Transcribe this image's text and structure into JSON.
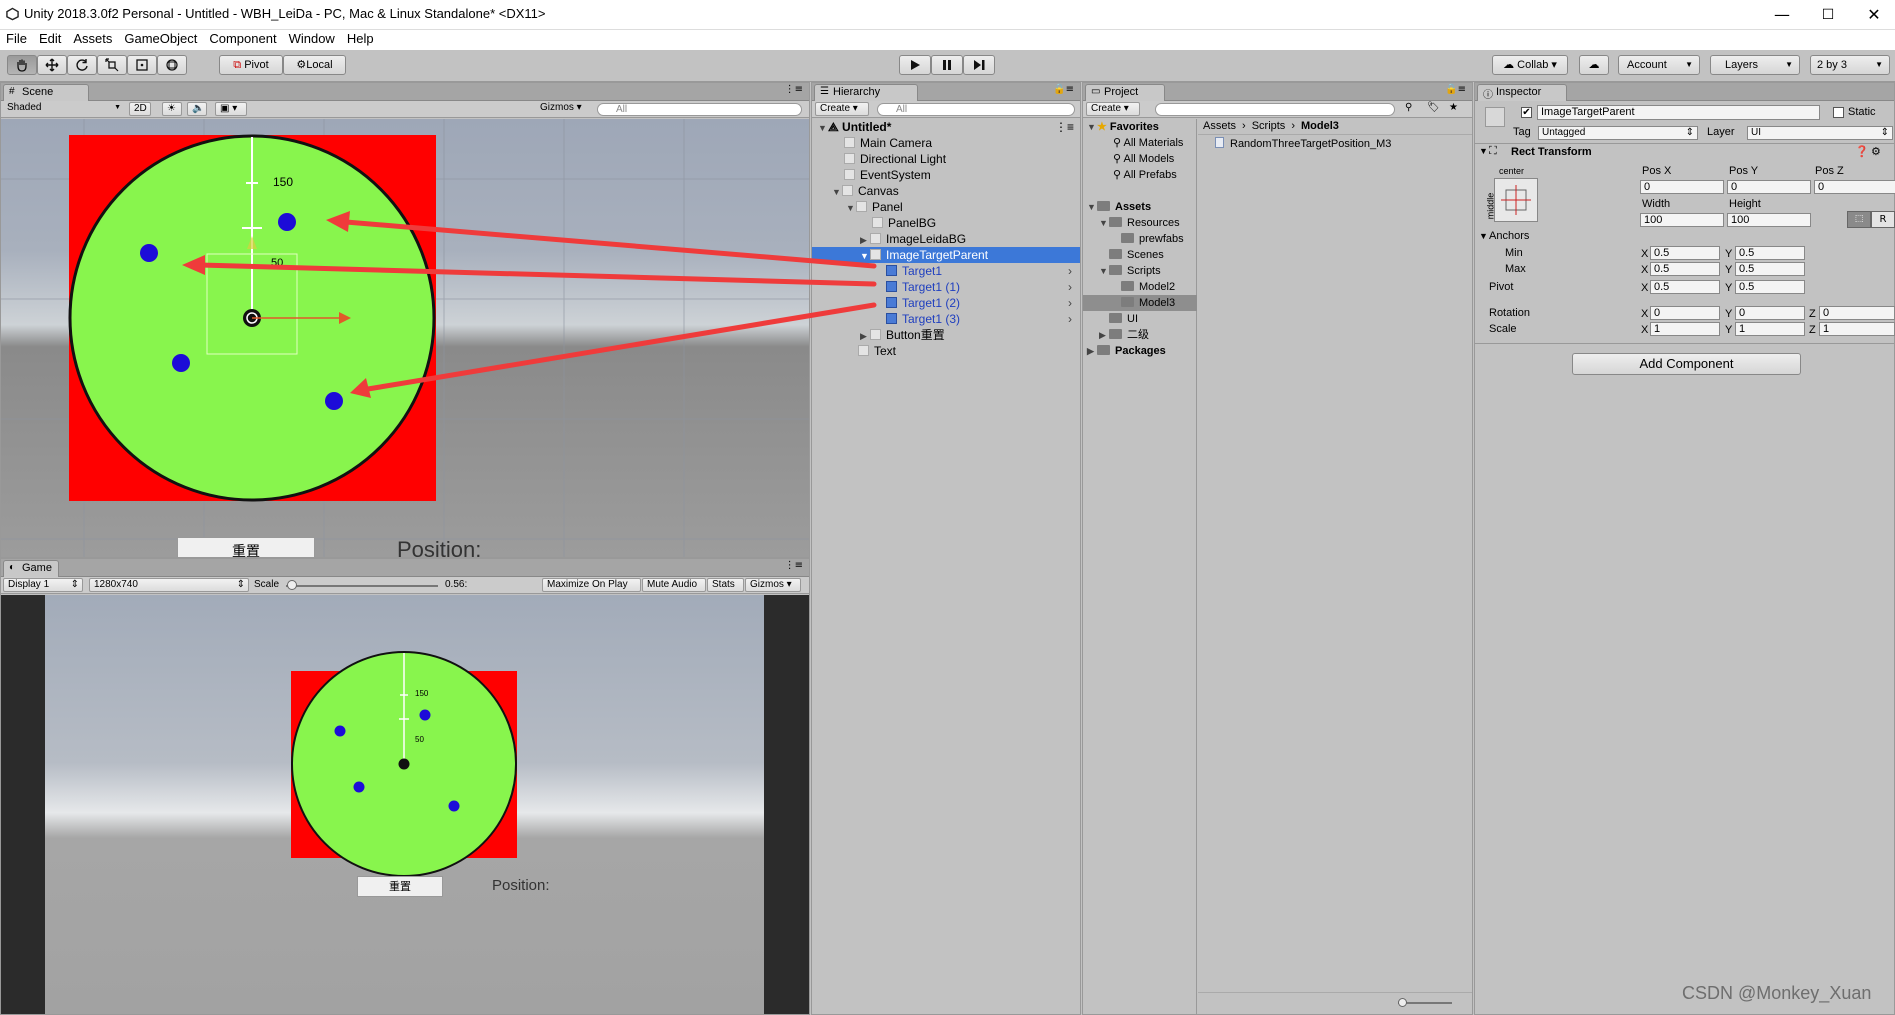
{
  "window": {
    "title": "Unity 2018.3.0f2 Personal - Untitled - WBH_LeiDa - PC, Mac & Linux Standalone* <DX11>",
    "minimize": "—",
    "maximize": "☐",
    "close": "✕"
  },
  "menu": [
    "File",
    "Edit",
    "Assets",
    "GameObject",
    "Component",
    "Window",
    "Help"
  ],
  "toolbar": {
    "pivot": "Pivot",
    "local": "Local",
    "collab": "Collab ▾",
    "account": "Account",
    "layers": "Layers",
    "layout": "2 by 3"
  },
  "scene": {
    "tab": "Scene",
    "shading": "Shaded",
    "mode2d": "2D",
    "gizmos": "Gizmos",
    "search": "All",
    "label_150": "150",
    "label_50": "50",
    "button_text": "重置",
    "position_text": "Position:"
  },
  "game": {
    "tab": "Game",
    "display": "Display 1",
    "resolution": "1280x740",
    "scale_label": "Scale",
    "scale_value": "0.56:",
    "maximize": "Maximize On Play",
    "mute": "Mute Audio",
    "stats": "Stats",
    "gizmos": "Gizmos",
    "label_150": "150",
    "label_50": "50",
    "button_text": "重置",
    "position_text": "Position:"
  },
  "hierarchy": {
    "tab": "Hierarchy",
    "create": "Create",
    "search": "All",
    "scene_root": "Untitled*",
    "items": [
      {
        "label": "Main Camera"
      },
      {
        "label": "Directional Light"
      },
      {
        "label": "EventSystem"
      },
      {
        "label": "Canvas"
      },
      {
        "label": "Panel"
      },
      {
        "label": "PanelBG"
      },
      {
        "label": "ImageLeidaBG"
      },
      {
        "label": "ImageTargetParent"
      },
      {
        "label": "Target1"
      },
      {
        "label": "Target1 (1)"
      },
      {
        "label": "Target1 (2)"
      },
      {
        "label": "Target1 (3)"
      },
      {
        "label": "Button重置"
      },
      {
        "label": "Text"
      }
    ]
  },
  "project": {
    "tab": "Project",
    "create": "Create",
    "favorites": "Favorites",
    "fav_items": [
      "All Materials",
      "All Models",
      "All Prefabs"
    ],
    "assets": "Assets",
    "asset_tree": [
      "Resources",
      "prewfabs",
      "Scenes",
      "Scripts",
      "Model2",
      "Model3",
      "UI",
      "二级"
    ],
    "packages": "Packages",
    "breadcrumb": [
      "Assets",
      "Scripts",
      "Model3"
    ],
    "file": "RandomThreeTargetPosition_M3"
  },
  "inspector": {
    "tab": "Inspector",
    "object_name": "ImageTargetParent",
    "static": "Static",
    "tag_label": "Tag",
    "tag_value": "Untagged",
    "layer_label": "Layer",
    "layer_value": "UI",
    "component": "Rect Transform",
    "anchor_h": "center",
    "anchor_v": "middle",
    "posx_label": "Pos X",
    "posy_label": "Pos Y",
    "posz_label": "Pos Z",
    "posx": "0",
    "posy": "0",
    "posz": "0",
    "width_label": "Width",
    "height_label": "Height",
    "width": "100",
    "height": "100",
    "r_button": "R",
    "anchors": "Anchors",
    "min": "Min",
    "max": "Max",
    "pivot": "Pivot",
    "rotation": "Rotation",
    "scale": "Scale",
    "min_x": "0.5",
    "min_y": "0.5",
    "max_x": "0.5",
    "max_y": "0.5",
    "pivot_x": "0.5",
    "pivot_y": "0.5",
    "rot_x": "0",
    "rot_y": "0",
    "rot_z": "0",
    "scale_x": "1",
    "scale_y": "1",
    "scale_z": "1",
    "x": "X",
    "y": "Y",
    "z": "Z",
    "add_component": "Add Component"
  },
  "watermark": "CSDN @Monkey_Xuan",
  "colors": {
    "radar_bg": "#ff0000",
    "radar_disc": "#88f54d",
    "target": "#1c0cd8",
    "arrow": "#ef3b3b",
    "selection": "#3c78d8"
  }
}
